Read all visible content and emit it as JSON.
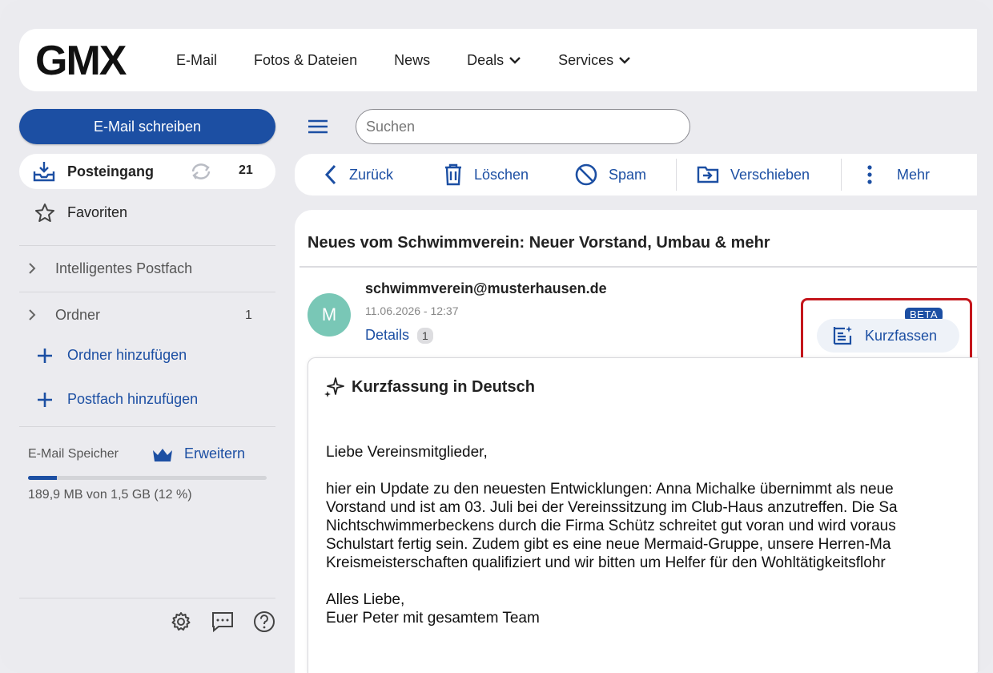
{
  "header": {
    "logo": "GMX",
    "nav": [
      {
        "label": "E-Mail",
        "dropdown": false
      },
      {
        "label": "Fotos & Dateien",
        "dropdown": false
      },
      {
        "label": "News",
        "dropdown": false
      },
      {
        "label": "Deals",
        "dropdown": true
      },
      {
        "label": "Services",
        "dropdown": true
      }
    ]
  },
  "sidebar": {
    "compose_label": "E-Mail schreiben",
    "inbox": {
      "label": "Posteingang",
      "count": "21",
      "icon": "inbox-icon"
    },
    "favorites": {
      "label": "Favoriten",
      "icon": "star-icon"
    },
    "smart_mailbox": {
      "label": "Intelligentes Postfach"
    },
    "folders": {
      "label": "Ordner",
      "count": "1"
    },
    "add_folder": "Ordner hinzufügen",
    "add_mailbox": "Postfach hinzufügen",
    "storage": {
      "label": "E-Mail Speicher",
      "upgrade": "Erweitern",
      "usage": "189,9 MB von 1,5 GB (12 %)",
      "percent": 12
    },
    "footer_icons": [
      "settings-icon",
      "feedback-icon",
      "help-icon"
    ]
  },
  "search": {
    "placeholder": "Suchen"
  },
  "toolbar": {
    "back": "Zurück",
    "delete": "Löschen",
    "spam": "Spam",
    "move": "Verschieben",
    "more": "Mehr"
  },
  "mail": {
    "subject": "Neues vom Schwimmverein: Neuer Vorstand, Umbau & mehr",
    "avatar_letter": "M",
    "sender": "schwimmverein@musterhausen.de",
    "date": "11.06.2026 - 12:37",
    "details_label": "Details",
    "details_count": "1",
    "summarize": {
      "badge": "BETA",
      "label": "Kurzfassen"
    }
  },
  "summary": {
    "title": "Kurzfassung in Deutsch",
    "greeting": "Liebe Vereinsmitglieder,",
    "lines": [
      "hier ein Update zu den neuesten Entwicklungen: Anna Michalke übernimmt als neue",
      "Vorstand und ist am 03. Juli bei der Vereinssitzung im Club-Haus anzutreffen. Die Sa",
      "Nichtschwimmerbeckens durch die Firma Schütz schreitet gut voran und wird voraus",
      "Schulstart fertig sein. Zudem gibt es eine neue Mermaid-Gruppe, unsere Herren-Ma",
      "Kreismeisterschaften qualifiziert und wir bitten um Helfer für den Wohltätigkeitsflohr"
    ],
    "closing": "Alles Liebe,",
    "signature": "Euer Peter mit gesamtem Team"
  },
  "colors": {
    "accent": "#1c4fa3",
    "highlight": "#c4161c",
    "avatar": "#79c7b6"
  }
}
